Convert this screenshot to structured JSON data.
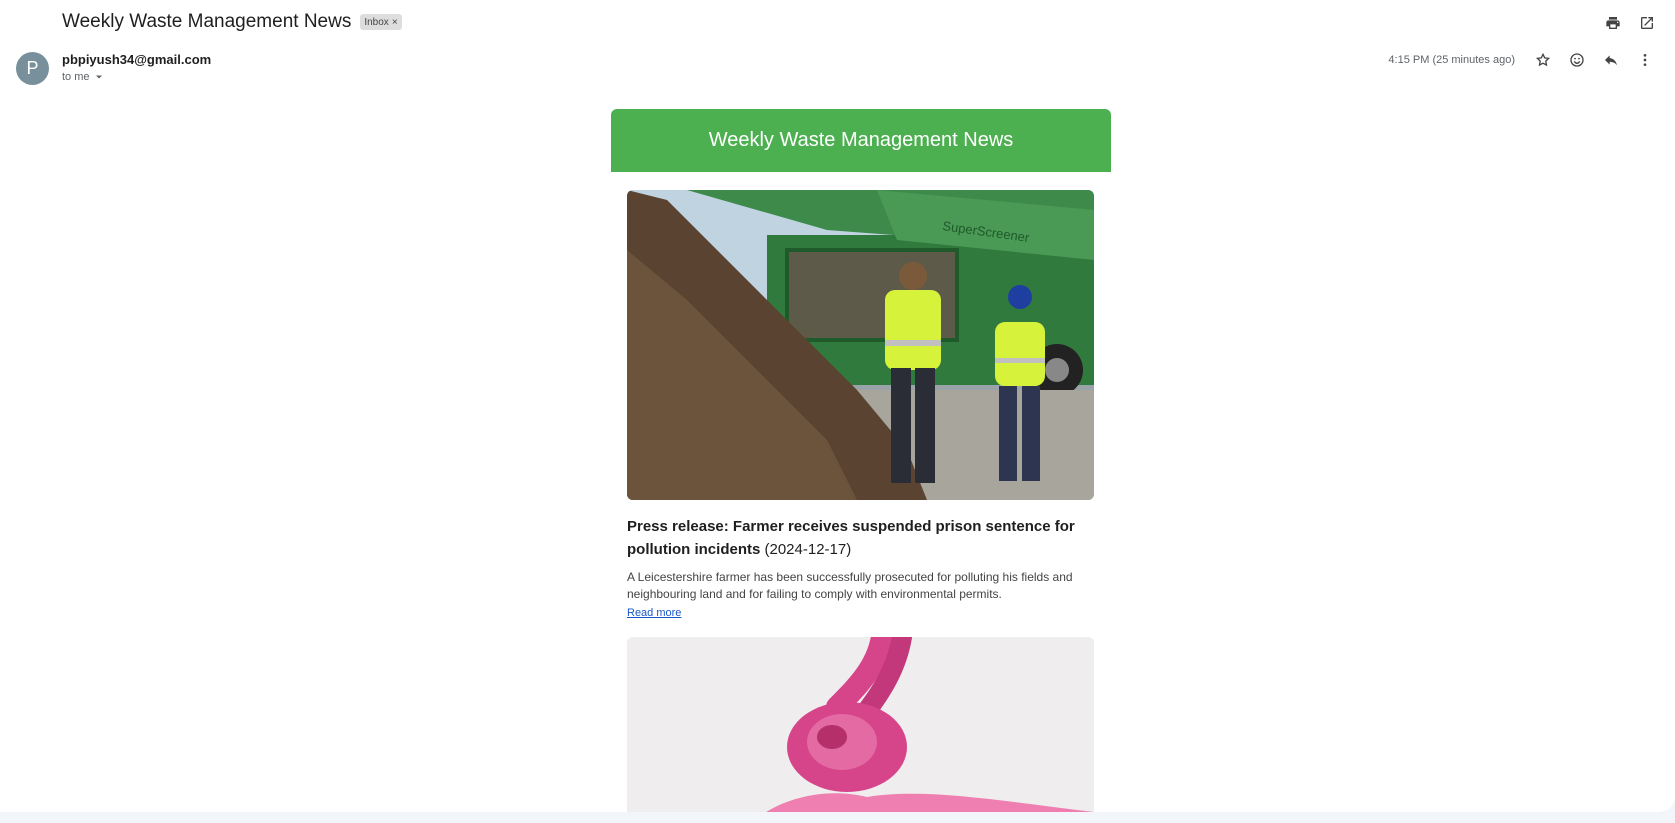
{
  "email": {
    "subject": "Weekly Waste Management News",
    "label": "Inbox",
    "label_close": "×",
    "sender_initial": "P",
    "sender": "pbpiyush34@gmail.com",
    "recipient": "to me",
    "time": "4:15 PM (25 minutes ago)"
  },
  "newsletter": {
    "banner_title": "Weekly Waste Management News",
    "articles": [
      {
        "title": "Press release: Farmer receives suspended prison sentence for pollution incidents",
        "date": "(2024-12-17)",
        "summary": "A Leicestershire farmer has been successfully prosecuted for polluting his fields and neighbouring land and for failing to comply with environmental permits.",
        "link": "Read more",
        "image_text": "SuperScreener"
      }
    ]
  },
  "icons": {
    "print": "print-icon",
    "open_new": "open-in-new-window-icon",
    "star": "star-icon",
    "emoji": "emoji-icon",
    "reply": "reply-icon",
    "more": "more-options-icon"
  },
  "colors": {
    "banner": "#4caf50",
    "link": "#1a57c7",
    "avatar": "#78909c"
  }
}
